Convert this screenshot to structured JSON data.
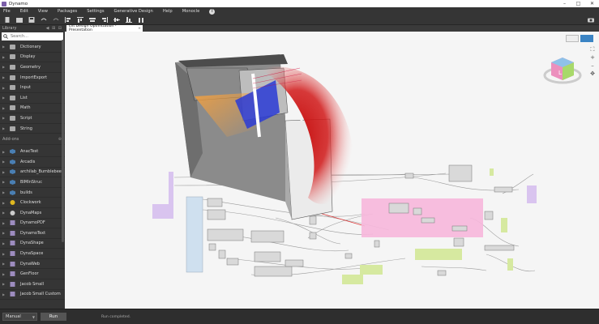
{
  "window": {
    "title": "Dynamo"
  },
  "menu": {
    "items": [
      "File",
      "Edit",
      "View",
      "Packages",
      "Settings",
      "Generative Design",
      "Help",
      "Monocle"
    ]
  },
  "library": {
    "header": "Library",
    "search_placeholder": "Search...",
    "categories": [
      "Dictionary",
      "Display",
      "Geometry",
      "ImportExport",
      "Input",
      "List",
      "Math",
      "Script",
      "String"
    ],
    "addons_label": "Add-ons",
    "packages": [
      "AnacTest",
      "Arcadis",
      "archilab_Bumblebee",
      "BIMInStruc",
      "builds",
      "Clockwork",
      "DynaMaps",
      "DynamoPDF",
      "DynamoText",
      "DynaShape",
      "DynaSpace",
      "DynaWeb",
      "GenFloor",
      "Jacob Small",
      "Jacob Small Custom"
    ]
  },
  "tab": {
    "label": "Lift Design Optimization - Presentation"
  },
  "bottom": {
    "run_mode": "Manual",
    "run_label": "Run",
    "status": "Run completed."
  },
  "colors": {
    "accent": "#3b84c4",
    "group_pink": "#f7b7db",
    "group_green": "#d6e9a0"
  }
}
